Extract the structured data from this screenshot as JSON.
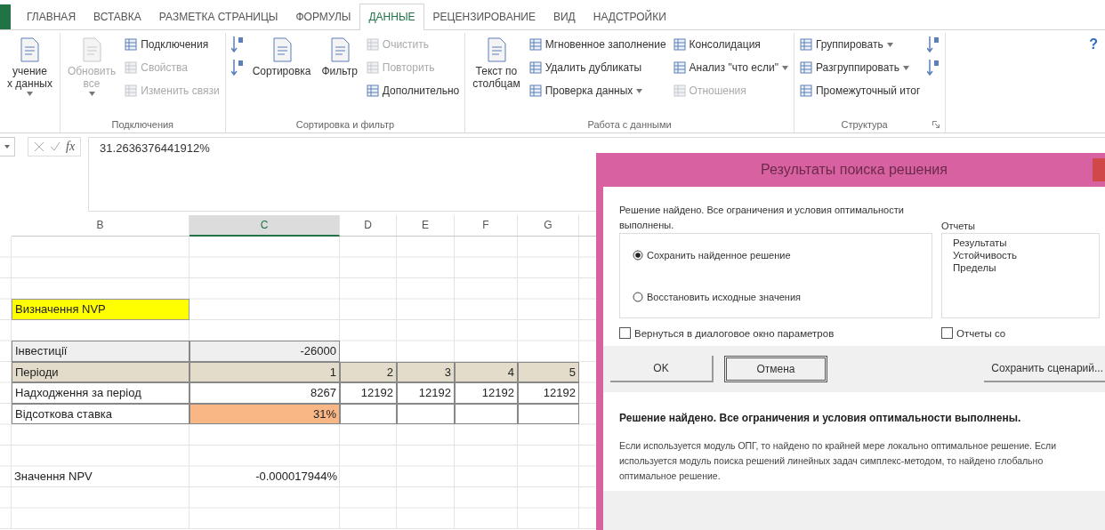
{
  "ribbon": {
    "tabs": [
      {
        "label": "ГЛАВНАЯ",
        "selected": false
      },
      {
        "label": "ВСТАВКА",
        "selected": false
      },
      {
        "label": "РАЗМЕТКА СТРАНИЦЫ",
        "selected": false
      },
      {
        "label": "ФОРМУЛЫ",
        "selected": false
      },
      {
        "label": "ДАННЫЕ",
        "selected": true
      },
      {
        "label": "РЕЦЕНЗИРОВАНИЕ",
        "selected": false
      },
      {
        "label": "ВИД",
        "selected": false
      },
      {
        "label": "НАДСТРОЙКИ",
        "selected": false
      }
    ],
    "groups": [
      {
        "columns": [
          [
            {
              "kind": "large",
              "label": "учение\nх данных",
              "disabled": false,
              "dropdown": true
            }
          ]
        ]
      },
      {
        "label": "Подключения",
        "columns": [
          [
            {
              "kind": "large",
              "label": "Обновить\nвсе",
              "disabled": true,
              "dropdown": true
            }
          ],
          [
            {
              "kind": "small",
              "label": "Подключения",
              "disabled": false
            },
            {
              "kind": "small",
              "label": "Свойства",
              "disabled": true
            },
            {
              "kind": "small",
              "label": "Изменить связи",
              "disabled": true
            }
          ]
        ]
      },
      {
        "label": "Сортировка и фильтр",
        "columns": [
          [
            {
              "kind": "icon",
              "disabled": false
            },
            {
              "kind": "icon",
              "disabled": false
            }
          ],
          [
            {
              "kind": "large",
              "label": "Сортировка",
              "disabled": false
            }
          ],
          [
            {
              "kind": "large",
              "label": "Фильтр",
              "disabled": false
            }
          ],
          [
            {
              "kind": "small",
              "label": "Очистить",
              "disabled": true
            },
            {
              "kind": "small",
              "label": "Повторить",
              "disabled": true
            },
            {
              "kind": "small",
              "label": "Дополнительно",
              "disabled": false
            }
          ]
        ]
      },
      {
        "label": "Работа с данными",
        "columns": [
          [
            {
              "kind": "large",
              "label": "Текст по\nстолбцам",
              "disabled": false
            }
          ],
          [
            {
              "kind": "small",
              "label": "Мгновенное заполнение",
              "disabled": false
            },
            {
              "kind": "small",
              "label": "Удалить дубликаты",
              "disabled": false
            },
            {
              "kind": "small",
              "label": "Проверка данных",
              "disabled": false,
              "dropdown": true
            }
          ],
          [
            {
              "kind": "small",
              "label": "Консолидация",
              "disabled": false
            },
            {
              "kind": "small",
              "label": "Анализ \"что если\"",
              "disabled": false,
              "dropdown": true
            },
            {
              "kind": "small",
              "label": "Отношения",
              "disabled": true
            }
          ]
        ]
      },
      {
        "label": "Структура",
        "launcher": true,
        "columns": [
          [
            {
              "kind": "small",
              "label": "Группировать",
              "disabled": false,
              "dropdown": true
            },
            {
              "kind": "small",
              "label": "Разгруппировать",
              "disabled": false,
              "dropdown": true
            },
            {
              "kind": "small",
              "label": "Промежуточный итог",
              "disabled": false
            }
          ],
          [
            {
              "kind": "icon",
              "disabled": false
            },
            {
              "kind": "icon",
              "disabled": false
            }
          ]
        ]
      }
    ],
    "help": "?"
  },
  "formula_bar": {
    "fx": "fx",
    "value": "31.2636376441912%"
  },
  "sheet": {
    "columns": [
      {
        "label": "B",
        "selected": false
      },
      {
        "label": "C",
        "selected": true
      },
      {
        "label": "D",
        "selected": false
      },
      {
        "label": "E",
        "selected": false
      },
      {
        "label": "F",
        "selected": false
      },
      {
        "label": "G",
        "selected": false
      }
    ],
    "rows": [
      {
        "kind": "blank"
      },
      {
        "kind": "blank"
      },
      {
        "kind": "blank"
      },
      {
        "kind": "data",
        "cells": [
          {
            "text": "Визначення NVP",
            "kind": "title"
          }
        ]
      },
      {
        "kind": "blank"
      },
      {
        "kind": "data",
        "cells": [
          {
            "text": "Інвестиції",
            "kind": "shaded"
          },
          {
            "text": "-26000",
            "kind": "shaded"
          }
        ]
      },
      {
        "kind": "data",
        "cells": [
          {
            "text": "Періоди",
            "kind": "band"
          },
          {
            "text": "1",
            "kind": "band"
          },
          {
            "text": "2",
            "kind": "band"
          },
          {
            "text": "3",
            "kind": "band"
          },
          {
            "text": "4",
            "kind": "band"
          },
          {
            "text": "5",
            "kind": "band"
          }
        ]
      },
      {
        "kind": "data",
        "cells": [
          {
            "text": "Надходження за період",
            "kind": "boxed"
          },
          {
            "text": "8267",
            "kind": "boxed"
          },
          {
            "text": "12192",
            "kind": "boxed"
          },
          {
            "text": "12192",
            "kind": "boxed"
          },
          {
            "text": "12192",
            "kind": "boxed"
          },
          {
            "text": "12192",
            "kind": "boxed"
          }
        ]
      },
      {
        "kind": "data",
        "cells": [
          {
            "text": "Відсоткова ставка",
            "kind": "boxed"
          },
          {
            "text": "31%",
            "kind": "input"
          },
          {
            "kind": "boxed"
          },
          {
            "kind": "boxed"
          },
          {
            "kind": "boxed"
          },
          {
            "kind": "boxed"
          }
        ]
      },
      {
        "kind": "blank"
      },
      {
        "kind": "blank"
      },
      {
        "kind": "data",
        "cells": [
          {
            "text": "Значення NPV",
            "kind": "plain"
          },
          {
            "text": "-0.000017944%",
            "kind": "plain"
          }
        ]
      },
      {
        "kind": "blank"
      },
      {
        "kind": "blank"
      }
    ]
  },
  "dialog": {
    "title": "Результаты поиска решения",
    "message": "Решение найдено. Все ограничения и условия оптимальности выполнены.",
    "options": [
      {
        "label": "Сохранить найденное решение",
        "selected": true
      },
      {
        "label": "Восстановить исходные значения",
        "selected": false
      }
    ],
    "reports_label": "Отчеты",
    "reports": [
      "Результаты",
      "Устойчивость",
      "Пределы"
    ],
    "checkboxes": [
      {
        "label": "Вернуться в диалоговое окно параметров",
        "checked": false
      },
      {
        "label": "Отчеты со",
        "checked": false
      }
    ],
    "buttons": [
      {
        "label": "OK",
        "default": false
      },
      {
        "label": "Отмена",
        "default": true
      }
    ],
    "save_button": "Сохранить сценарий...",
    "summary": "Решение найдено. Все ограничения и условия оптимальности выполнены.",
    "details": "Если используется модуль ОПГ, то найдено по крайней мере локально оптимальное решение. Если используется модуль поиска решений линейных задач симплекс-методом, то найдено глобально оптимальное решение."
  }
}
